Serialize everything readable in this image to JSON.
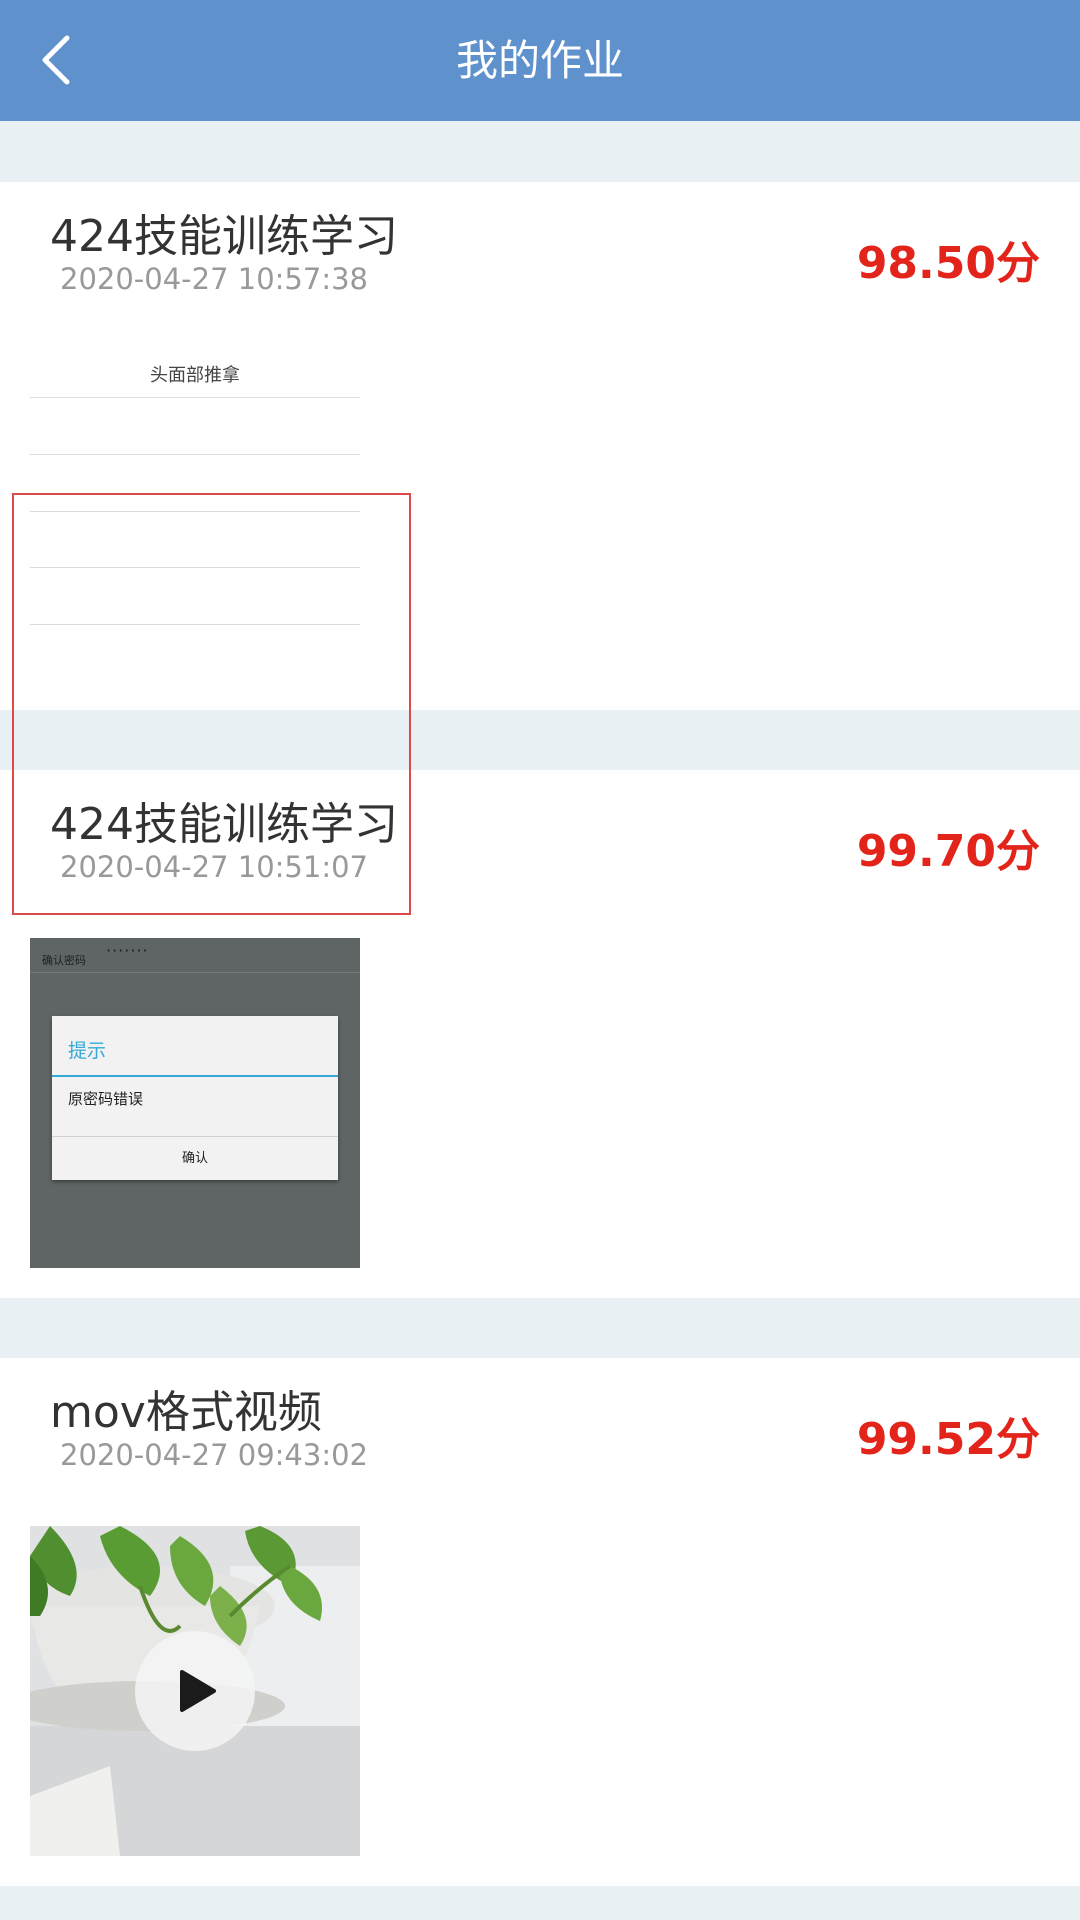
{
  "header": {
    "title": "我的作业",
    "back_icon": "chevron-left-icon",
    "background": "#5f91cc"
  },
  "homework": [
    {
      "title": "424技能训练学习",
      "time": "2020-04-27 10:57:38",
      "score": "98.50分",
      "thumbnail": {
        "type": "form",
        "heading": "头面部推拿"
      }
    },
    {
      "title": "424技能训练学习",
      "time": "2020-04-27 10:51:07",
      "score": "99.70分",
      "thumbnail": {
        "type": "dialog",
        "field_label": "确认密码",
        "field_value": "·······",
        "dialog_title": "提示",
        "dialog_message": "原密码错误",
        "dialog_button": "确认"
      }
    },
    {
      "title": "mov格式视频",
      "time": "2020-04-27 09:43:02",
      "score": "99.52分",
      "thumbnail": {
        "type": "video",
        "play_icon": "play-icon"
      }
    }
  ],
  "colors": {
    "score": "#e3241b",
    "page_background": "#e9f0f4",
    "dialog_accent": "#33a9d6",
    "highlight": "#de4a4a"
  }
}
